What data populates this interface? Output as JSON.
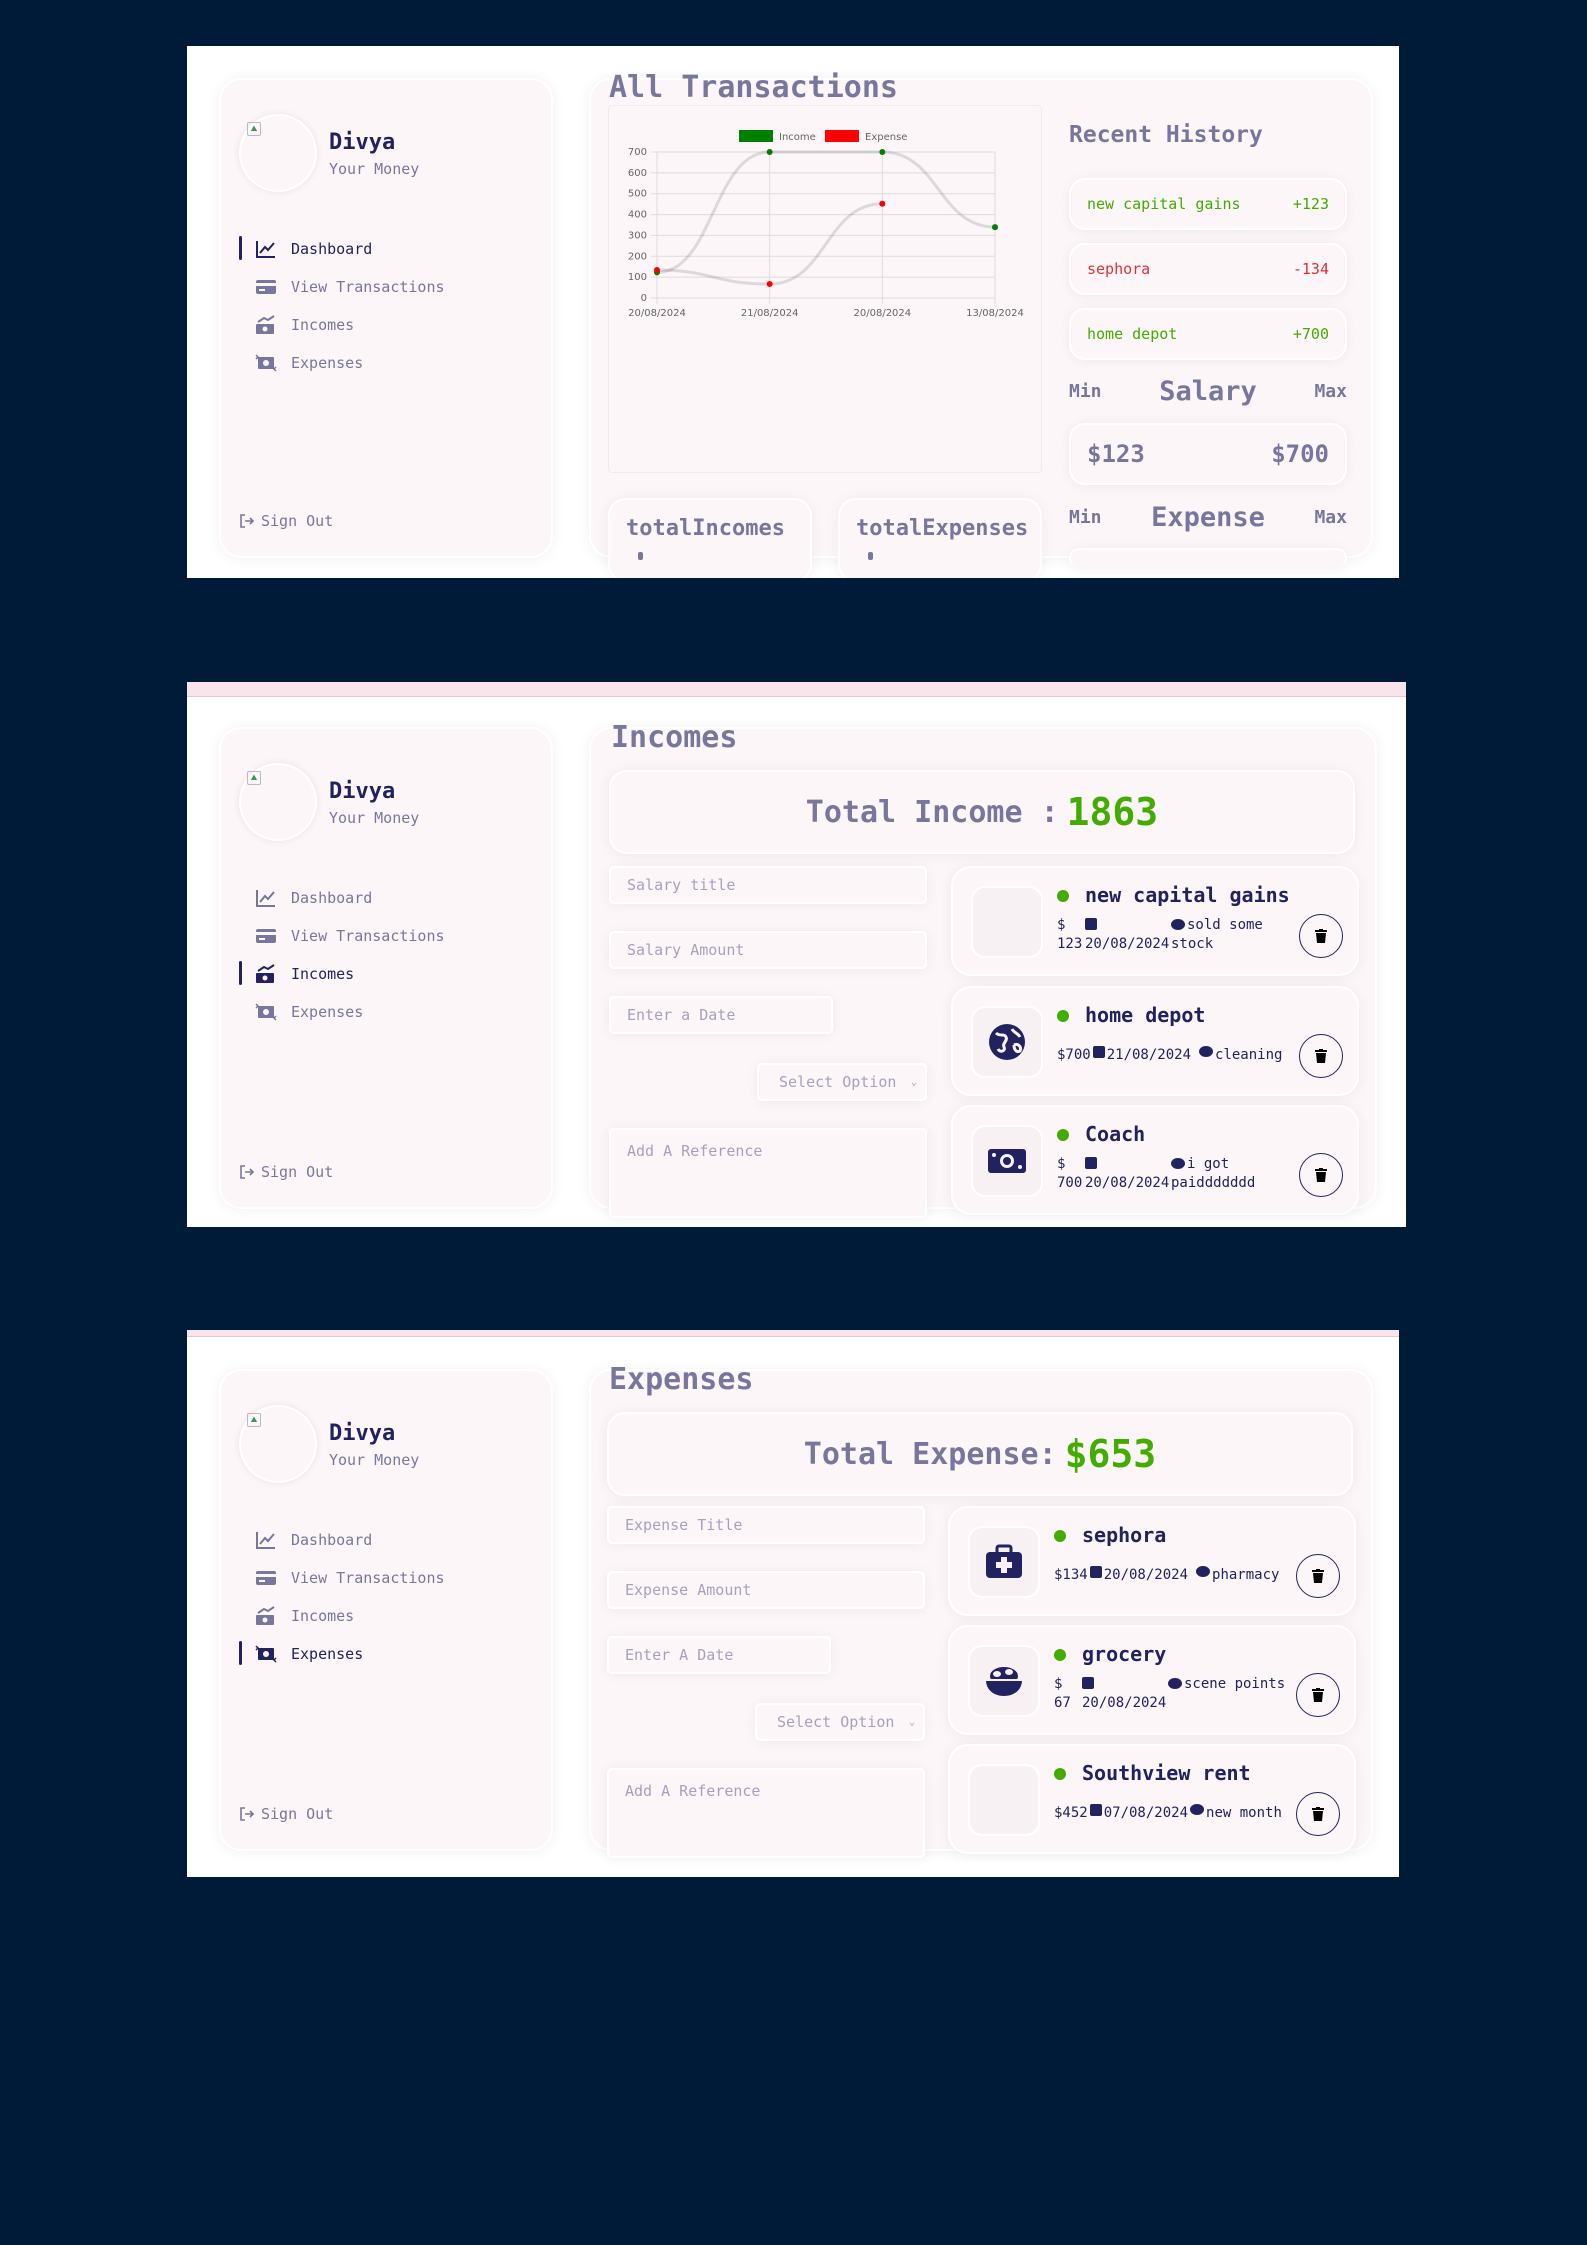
{
  "user": {
    "name": "Divya",
    "subtitle": "Your Money"
  },
  "nav": {
    "items": [
      {
        "label": "Dashboard",
        "icon": "chart-line-icon"
      },
      {
        "label": "View Transactions",
        "icon": "credit-card-icon"
      },
      {
        "label": "Incomes",
        "icon": "money-bill-trend-up-icon"
      },
      {
        "label": "Expenses",
        "icon": "money-bill-transfer-icon"
      }
    ],
    "signout": "Sign Out"
  },
  "dashboard": {
    "title": "All Transactions",
    "total_incomes_label": "totalIncomes",
    "total_expenses_label": "totalExpenses",
    "history": {
      "title": "Recent History",
      "items": [
        {
          "title": "new capital gains",
          "amount": "+123",
          "type": "income"
        },
        {
          "title": "sephora",
          "amount": "-134",
          "type": "expense"
        },
        {
          "title": "home depot",
          "amount": "+700",
          "type": "income"
        }
      ]
    },
    "salary": {
      "min_label": "Min",
      "title": "Salary",
      "max_label": "Max",
      "min_value": "$123",
      "max_value": "$700"
    },
    "expense": {
      "min_label": "Min",
      "title": "Expense",
      "max_label": "Max"
    }
  },
  "incomes": {
    "title": "Incomes",
    "total_label": "Total Income :",
    "total_value": "1863",
    "form": {
      "title_placeholder": "Salary title",
      "amount_placeholder": "Salary Amount",
      "date_placeholder": "Enter a Date",
      "select_placeholder": "Select Option",
      "reference_placeholder": "Add A Reference"
    },
    "items": [
      {
        "title": "new capital gains",
        "amount": "$ 123",
        "date": "20/08/2024",
        "note": "sold some stock",
        "icon": "empty"
      },
      {
        "title": "home depot",
        "amount": "$700",
        "date": "21/08/2024",
        "note": "cleaning",
        "icon": "globe-icon"
      },
      {
        "title": "Coach",
        "amount": "$ 700",
        "date": "20/08/2024",
        "note": "i got paiddddddd",
        "icon": "money-bill-icon"
      }
    ]
  },
  "expenses": {
    "title": "Expenses",
    "total_label": "Total Expense:",
    "total_value": "$653",
    "form": {
      "title_placeholder": "Expense Title",
      "amount_placeholder": "Expense Amount",
      "date_placeholder": "Enter A Date",
      "select_placeholder": "Select Option",
      "reference_placeholder": "Add A Reference"
    },
    "items": [
      {
        "title": "sephora",
        "amount": "$134",
        "date": "20/08/2024",
        "note": "pharmacy",
        "icon": "medical-kit-icon"
      },
      {
        "title": "grocery",
        "amount": "$ 67",
        "date": "20/08/2024",
        "note": "scene points",
        "icon": "bowl-food-icon"
      },
      {
        "title": "Southview rent",
        "amount": "$452",
        "date": "07/08/2024",
        "note": "new month",
        "icon": "empty"
      }
    ]
  },
  "chart_data": {
    "type": "line",
    "categories": [
      "20/08/2024",
      "21/08/2024",
      "20/08/2024",
      "13/08/2024"
    ],
    "series": [
      {
        "name": "Income",
        "color": "#008000",
        "values": [
          123,
          700,
          700,
          340
        ]
      },
      {
        "name": "Expense",
        "color": "#ff0000",
        "values": [
          134,
          67,
          452,
          null
        ]
      }
    ],
    "ylim": [
      0,
      700
    ],
    "yticks": [
      0,
      100,
      200,
      300,
      400,
      500,
      600,
      700
    ],
    "grid": true,
    "legend": "top-center"
  },
  "colors": {
    "income": "#42ad00",
    "expense": "#e0303a",
    "primary": "#222260",
    "background": "#001b37"
  }
}
